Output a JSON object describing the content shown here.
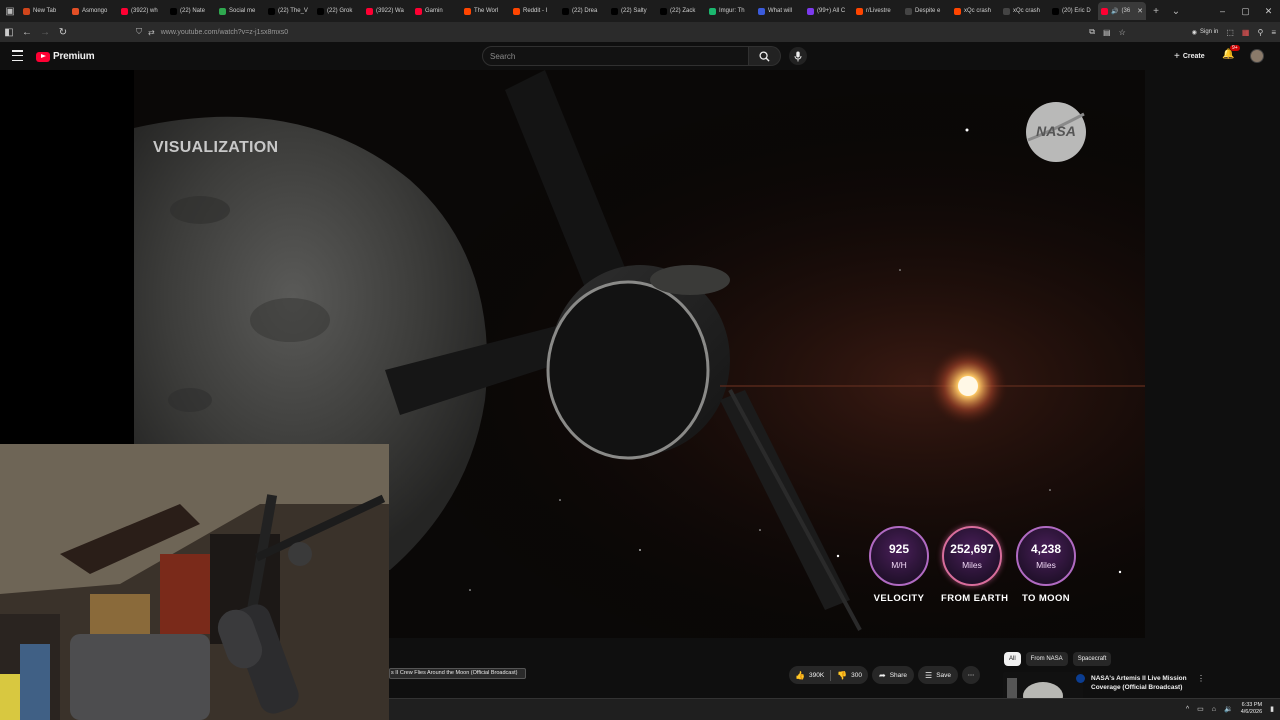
{
  "browser": {
    "tabs": [
      {
        "title": "New Tab",
        "color": "#d0451b"
      },
      {
        "title": "Asmongo",
        "color": "#e34f26"
      },
      {
        "title": "(3922) wh",
        "color": "#ff0033"
      },
      {
        "title": "(22) Nate",
        "color": "#000000"
      },
      {
        "title": "Social me",
        "color": "#2fa84f"
      },
      {
        "title": "(22) The_V",
        "color": "#000000"
      },
      {
        "title": "(22) Grok",
        "color": "#000000"
      },
      {
        "title": "(3922) Wa",
        "color": "#ff0033"
      },
      {
        "title": "Gamin",
        "color": "#ff0033"
      },
      {
        "title": "The Worl",
        "color": "#ff4500"
      },
      {
        "title": "Reddit - I",
        "color": "#ff4500"
      },
      {
        "title": "(22) Drea",
        "color": "#000000"
      },
      {
        "title": "(22) Salty",
        "color": "#000000"
      },
      {
        "title": "(22) Zack",
        "color": "#000000"
      },
      {
        "title": "Imgur: Th",
        "color": "#1bb76e"
      },
      {
        "title": "What will",
        "color": "#3b5bdb"
      },
      {
        "title": "(99+) All C",
        "color": "#7c3aed"
      },
      {
        "title": "r/Livestre",
        "color": "#ff4500"
      },
      {
        "title": "Despite e",
        "color": "#444444"
      },
      {
        "title": "xQc crash",
        "color": "#ff4500"
      },
      {
        "title": "xQc crash",
        "color": "#444444"
      },
      {
        "title": "(20) Eric D",
        "color": "#000000"
      }
    ],
    "active_tab": {
      "title": "(36"
    },
    "url": "www.youtube.com/watch?v=z-j1sx8mxs0",
    "signin_label": "Sign in"
  },
  "youtube": {
    "logo_text": "Premium",
    "search_placeholder": "Search",
    "create_label": "Create",
    "notif_badge": "9+"
  },
  "player": {
    "overlay_label": "VISUALIZATION",
    "nasa_logo_text": "NASA",
    "stats": [
      {
        "value": "925",
        "unit": "M/H",
        "label": "VELOCITY"
      },
      {
        "value": "252,697",
        "unit": "Miles",
        "label": "FROM EARTH"
      },
      {
        "value": "4,238",
        "unit": "Miles",
        "label": "TO MOON"
      }
    ]
  },
  "video": {
    "title_fragment": "s II Crew Flies Around the Moon (Official Broadcast)",
    "likes": "390K",
    "dislikes": "300",
    "share_label": "Share",
    "save_label": "Save"
  },
  "sidebar": {
    "chips": [
      "All",
      "From NASA",
      "Spacecraft"
    ],
    "recommendation": {
      "title": "NASA's Artemis II Live Mission Coverage (Official Broadcast)"
    }
  },
  "taskbar": {
    "time": "6:33 PM",
    "date": "4/6/2026"
  },
  "colors": {
    "youtube_red": "#ff0033",
    "stat_ring": "#b06ac2"
  }
}
